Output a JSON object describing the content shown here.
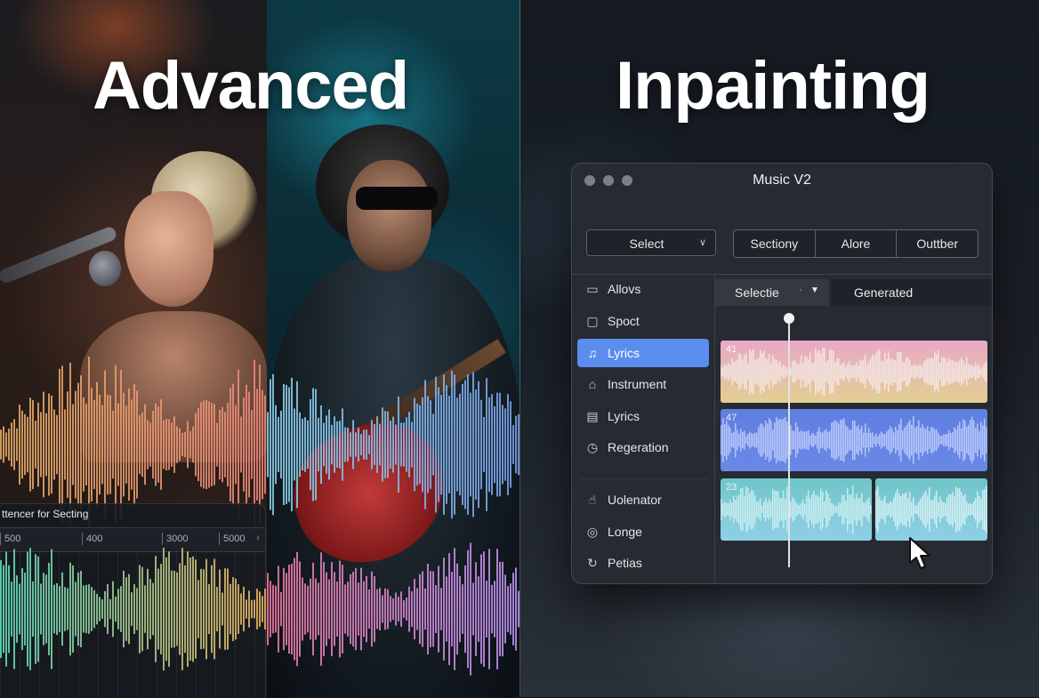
{
  "headings": {
    "left": "Advanced",
    "right": "Inpainting"
  },
  "mini_panel": {
    "title": "ttencer for Secting",
    "ticks": [
      "500",
      "400",
      "3000",
      "5000"
    ],
    "arrow_icon": "chevron-left-icon"
  },
  "window": {
    "title": "Music V2",
    "toolbar": {
      "select_label": "Select",
      "segments": [
        "Sectiony",
        "Alore",
        "Outtber"
      ]
    },
    "sidebar": [
      {
        "label": "Allovs",
        "icon": "folder-icon"
      },
      {
        "label": "Spoct",
        "icon": "chat-icon"
      },
      {
        "label": "Lyrics",
        "icon": "music-note-icon",
        "active": true
      },
      {
        "label": "Instrument",
        "icon": "home-icon"
      },
      {
        "label": "Lyrics",
        "icon": "document-icon"
      },
      {
        "label": "Regeration",
        "icon": "clock-icon"
      },
      {
        "label": "Uolenator",
        "icon": "hand-icon"
      },
      {
        "label": "Longe",
        "icon": "toggle-icon"
      },
      {
        "label": "Petias",
        "icon": "refresh-icon"
      }
    ],
    "editor": {
      "tab_select_label": "Selectie",
      "tab_generated_label": "Generated",
      "tracks": [
        {
          "number": "41",
          "colors": [
            "#e8a9c6",
            "#e3cf92"
          ]
        },
        {
          "number": "47",
          "colors": [
            "#5f7fe0",
            "#6a88e6"
          ]
        },
        {
          "number": "23",
          "colors": [
            "#6fc5c8",
            "#8fd0e6"
          ]
        }
      ]
    }
  }
}
